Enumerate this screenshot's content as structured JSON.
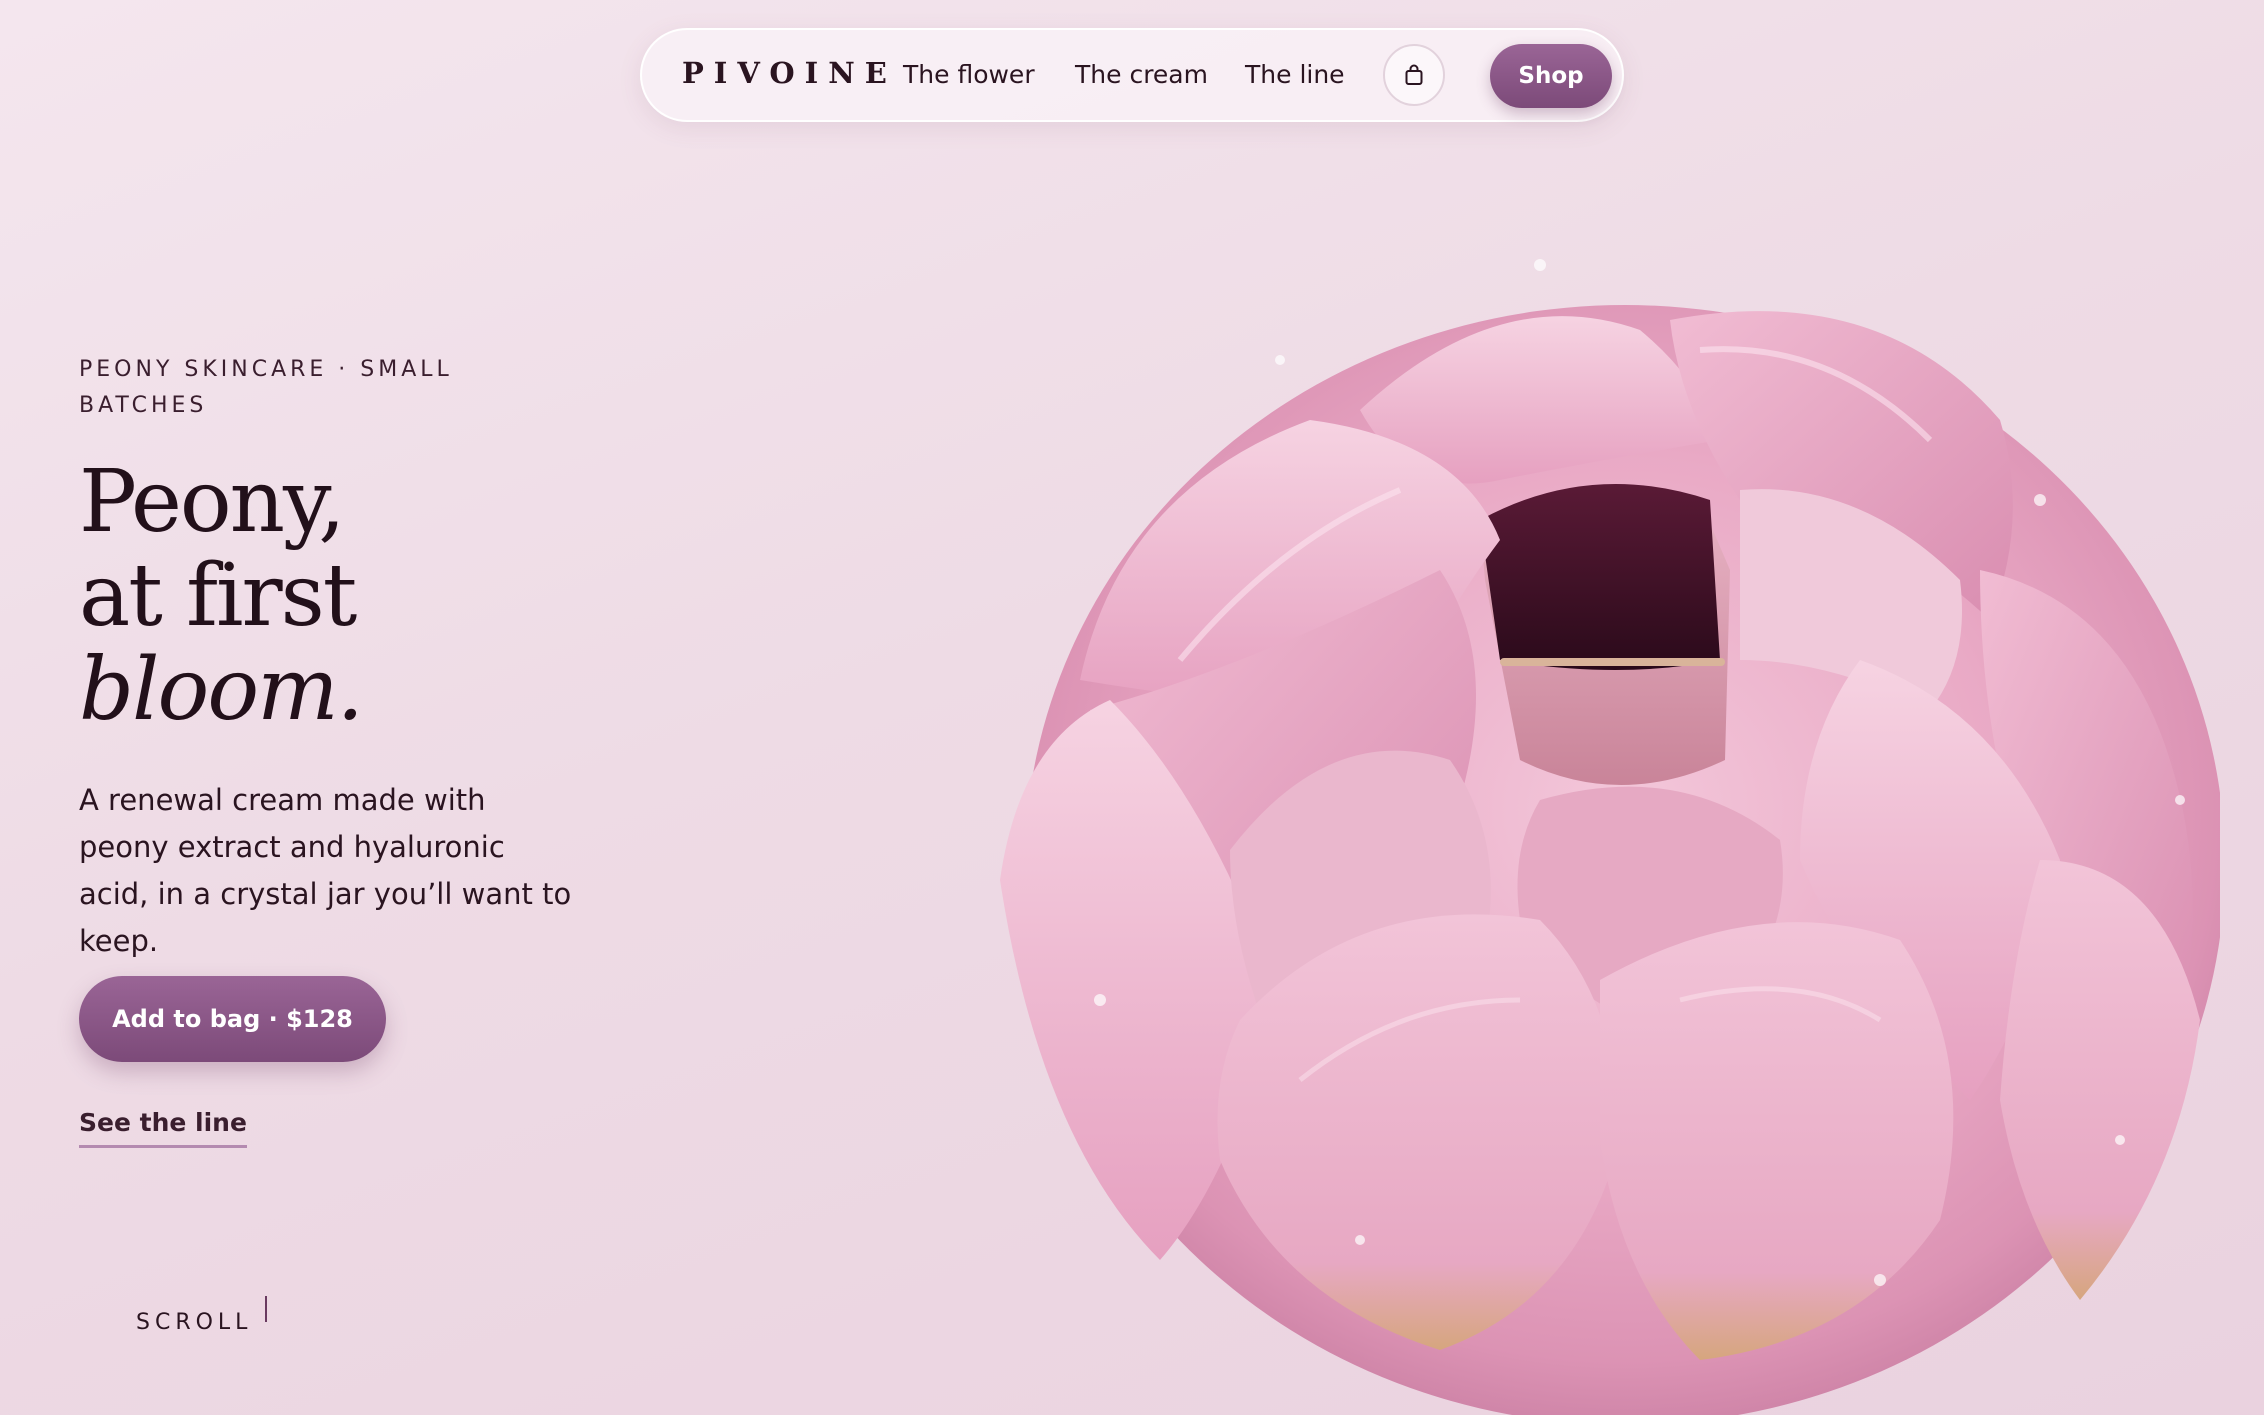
{
  "nav": {
    "brand": "PIVOINE",
    "links": [
      "The flower",
      "The cream",
      "The line"
    ],
    "bag_icon": "shopping-bag-icon",
    "shop_label": "Shop"
  },
  "hero": {
    "eyebrow": "PEONY SKINCARE · SMALL BATCHES",
    "headline_line1": "Peony,",
    "headline_line2": "at first",
    "headline_line3": "bloom.",
    "description": "A renewal cream made with peony extract and hyaluronic acid, in a crystal jar you’ll want to keep.",
    "cta_label": "Add to bag · $128",
    "secondary_link": "See the line",
    "scroll_label": "SCROLL"
  },
  "colors": {
    "accent": "#8a5886",
    "background": "#f0dfe8",
    "text": "#22101a",
    "petal": "#e9a9c5"
  }
}
